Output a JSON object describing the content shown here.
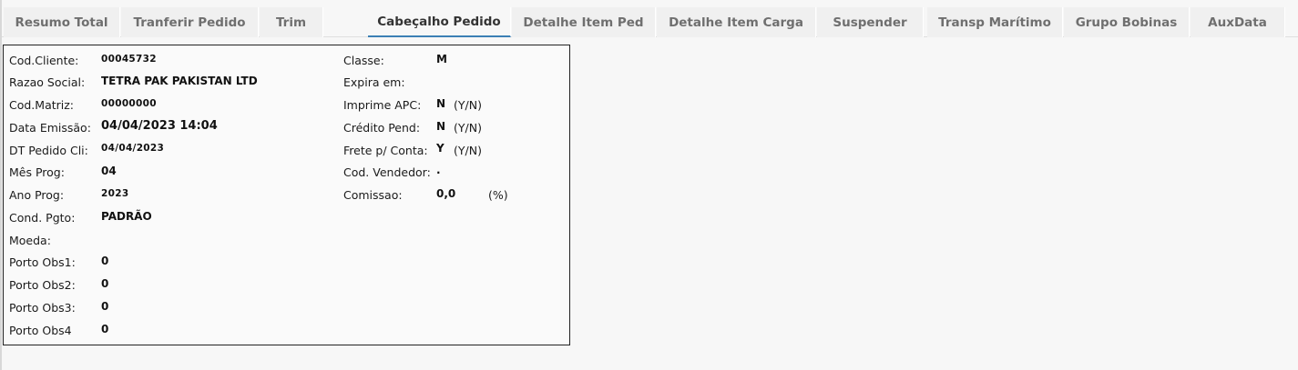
{
  "tabs": [
    {
      "label": "Resumo Total"
    },
    {
      "label": "Tranferir Pedido"
    },
    {
      "label": "Trim"
    },
    {
      "label": "Cabeçalho Pedido"
    },
    {
      "label": "Detalhe Item Ped"
    },
    {
      "label": "Detalhe Item Carga"
    },
    {
      "label": "Suspender"
    },
    {
      "label": "Transp Marítimo"
    },
    {
      "label": "Grupo Bobinas"
    },
    {
      "label": "AuxData"
    }
  ],
  "active_tab": "Cabeçalho Pedido",
  "left_fields": {
    "cod_cliente": {
      "label": "Cod.Cliente:",
      "value": "00045732"
    },
    "razao_social": {
      "label": "Razao Social:",
      "value": "TETRA PAK PAKISTAN LTD"
    },
    "cod_matriz": {
      "label": "Cod.Matriz:",
      "value": "00000000"
    },
    "data_emissao": {
      "label": "Data Emissão:",
      "value": "04/04/2023 14:04"
    },
    "dt_pedido_cli": {
      "label": "DT Pedido Cli:",
      "value": "04/04/2023"
    },
    "mes_prog": {
      "label": "Mês Prog:",
      "value": "04"
    },
    "ano_prog": {
      "label": "Ano Prog:",
      "value": "2023"
    },
    "cond_pgto": {
      "label": "Cond. Pgto:",
      "value": "PADRÃO"
    },
    "moeda": {
      "label": "Moeda:",
      "value": ""
    },
    "porto_obs1": {
      "label": "Porto Obs1:",
      "value": "0"
    },
    "porto_obs2": {
      "label": "Porto Obs2:",
      "value": "0"
    },
    "porto_obs3": {
      "label": "Porto Obs3:",
      "value": "0"
    },
    "porto_obs4": {
      "label": "Porto Obs4",
      "value": "0"
    }
  },
  "right_fields": {
    "classe": {
      "label": "Classe:",
      "value": "M"
    },
    "expira_em": {
      "label": "Expira em:",
      "value": ""
    },
    "imprime_apc": {
      "label": "Imprime APC:",
      "value": "N",
      "hint": "(Y/N)"
    },
    "credito_pend": {
      "label": "Crédito Pend:",
      "value": "N",
      "hint": "(Y/N)"
    },
    "frete_conta": {
      "label": "Frete p/ Conta:",
      "value": "Y",
      "hint": "(Y/N)"
    },
    "cod_vendedor": {
      "label": "Cod. Vendedor:",
      "value": "."
    },
    "comissao": {
      "label": "Comissao:",
      "value": "0,0",
      "hint": "(%)"
    }
  }
}
